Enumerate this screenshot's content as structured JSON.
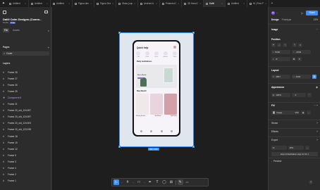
{
  "tabs": [
    {
      "label": "Untitled"
    },
    {
      "label": "Untitled"
    },
    {
      "label": "Untitled"
    },
    {
      "label": "Figma desi"
    },
    {
      "label": "Figma Desi"
    },
    {
      "label": "Glass (cop"
    },
    {
      "label": "Android A"
    },
    {
      "label": "Pinterest Gr"
    },
    {
      "label": "3D Hand Ge"
    },
    {
      "label": "Dalili"
    },
    {
      "label": "Untitled"
    },
    {
      "label": "Hi | Free Fi"
    }
  ],
  "left_panel": {
    "file_title": "Dalili Calm Designs (Comm...",
    "file_sub": "Drafts",
    "file_pill": "Free",
    "tab_file": "File",
    "tab_assets": "Assets",
    "pages_label": "Pages",
    "page_cover": "Cover",
    "layers_label": "Layers",
    "layers": [
      {
        "label": "Frame 28",
        "kind": "frame"
      },
      {
        "label": "Frame 27",
        "kind": "frame"
      },
      {
        "label": "Frame 26",
        "kind": "frame"
      },
      {
        "label": "Frame 25",
        "kind": "frame"
      },
      {
        "label": "Component 5",
        "kind": "component"
      },
      {
        "label": "Frame 21",
        "kind": "frame"
      },
      {
        "label": "Frame 20_old_124:097",
        "kind": "frame"
      },
      {
        "label": "Frame 20_old_124:097",
        "kind": "frame"
      },
      {
        "label": "Frame 20_old_124:003",
        "kind": "frame"
      },
      {
        "label": "Frame 20_old_123:238",
        "kind": "frame"
      },
      {
        "label": "Frame 18",
        "kind": "frame"
      },
      {
        "label": "Frame 19",
        "kind": "frame"
      },
      {
        "label": "Frame 12",
        "kind": "frame"
      },
      {
        "label": "Frame 5",
        "kind": "frame"
      },
      {
        "label": "Frame 3",
        "kind": "frame"
      },
      {
        "label": "Frame 4",
        "kind": "frame"
      },
      {
        "label": "Frame 2",
        "kind": "frame"
      },
      {
        "label": "Frame 1",
        "kind": "frame"
      }
    ]
  },
  "canvas": {
    "frame_label": "390 × 844",
    "phone": {
      "header": "Quick help",
      "moods": [
        {
          "label": "Calm"
        },
        {
          "label": "Relax"
        },
        {
          "label": "Focus"
        },
        {
          "label": "Anxious"
        },
        {
          "label": "Sleep"
        }
      ],
      "daily_title": "Daily meditations",
      "banner_text": "Start a Break",
      "new_title": "New Beach",
      "card_labels": [
        "Morning Breathe",
        "Soft Bloom",
        "Uplift Reset"
      ]
    }
  },
  "toolbar": {
    "tools": [
      {
        "name": "move",
        "glyph": "▷"
      },
      {
        "name": "frame",
        "glyph": "#"
      },
      {
        "name": "shape",
        "glyph": "□"
      },
      {
        "name": "pen",
        "glyph": "✒"
      },
      {
        "name": "text",
        "glyph": "T"
      },
      {
        "name": "comment",
        "glyph": "◯"
      },
      {
        "name": "actions",
        "glyph": "⊞"
      }
    ],
    "dev_glyph": "</>"
  },
  "right_panel": {
    "avatar_letter": "D",
    "share_label": "Share",
    "tab_design": "Design",
    "tab_prototype": "Prototype",
    "zoom": "13%",
    "image_label": "Image",
    "position_label": "Position",
    "x_value": "8440",
    "y_value": "-2503",
    "rotation": "0°",
    "layout_label": "Layout",
    "w_value": "2847",
    "h_value": "4334",
    "appearance_label": "Appearance",
    "opacity": "100%",
    "corner": "0",
    "fill_label": "Fill",
    "fill_value": "Image",
    "fill_opacity": "100",
    "stroke_label": "Stroke",
    "effects_label": "Effects",
    "export_label": "Export",
    "export_scale": "1x",
    "export_format": "JPG",
    "export_button": "Export Meditation App UI Kit 1",
    "preview_label": "Preview"
  },
  "colors": {
    "accent": "#3a90ff",
    "component": "#b99cff",
    "panel": "#2c2c2c",
    "canvas": "#1e1e1e"
  }
}
